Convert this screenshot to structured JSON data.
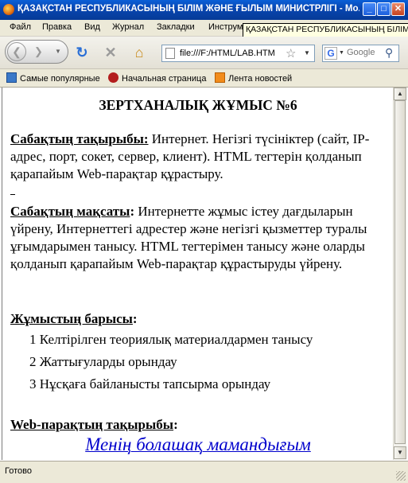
{
  "window": {
    "title": "ҚАЗАҚСТАН РЕСПУБЛИКАСЫНЫҢ БІЛІМ ЖӘНЕ ҒЫЛЫМ МИНИСТРЛІГІ - Mo...",
    "tooltip": "ҚАЗАҚСТАН РЕСПУБЛИКАСЫНЫҢ БІЛІМ"
  },
  "menu": {
    "file": "Файл",
    "edit": "Правка",
    "view": "Вид",
    "history": "Журнал",
    "bookmarks": "Закладки",
    "tools": "Инструм"
  },
  "navbar": {
    "url": "file:///F:/HTML/LAB.HTM",
    "search_placeholder": "Google"
  },
  "bookmarks_bar": {
    "items": [
      "Самые популярные",
      "Начальная страница",
      "Лента новостей"
    ]
  },
  "document": {
    "heading": "ЗЕРТХАНАЛЫҚ  ЖҰМЫС №6",
    "topic_label": "Сабақтың тақырыбы:",
    "topic_text": " Интернет. Негізгі түсініктер (сайт, IP-адрес, порт, сокет, сервер, клиент). HTML тегтерін қолданып қарапайым Web-парақтар   құрастыру.",
    "goal_label": "Сабақтың мақсаты",
    "goal_colon": ":",
    "goal_text": " Интернетте жұмыс істеу дағдыларын үйрену, Интернеттегі адрестер  және негізгі қызметтер туралы ұғымдарымен танысу. HTML тегтерімен танысу және оларды қолданып қарапайым Web-парақтар   құрастыруды үйрену.",
    "progress_label": "Жұмыстың барысы",
    "progress_colon": ":",
    "steps": [
      "1 Келтірілген теориялық материалдармен танысу",
      "2 Жаттығуларды орындау",
      "3 Нұсқаға байланысты тапсырма орындау"
    ],
    "webpage_topic_label": "Web-парақтың тақырыбы",
    "webpage_topic_colon": ":",
    "webpage_link": "Менің болашақ мамандығым"
  },
  "status": {
    "text": "Готово"
  }
}
